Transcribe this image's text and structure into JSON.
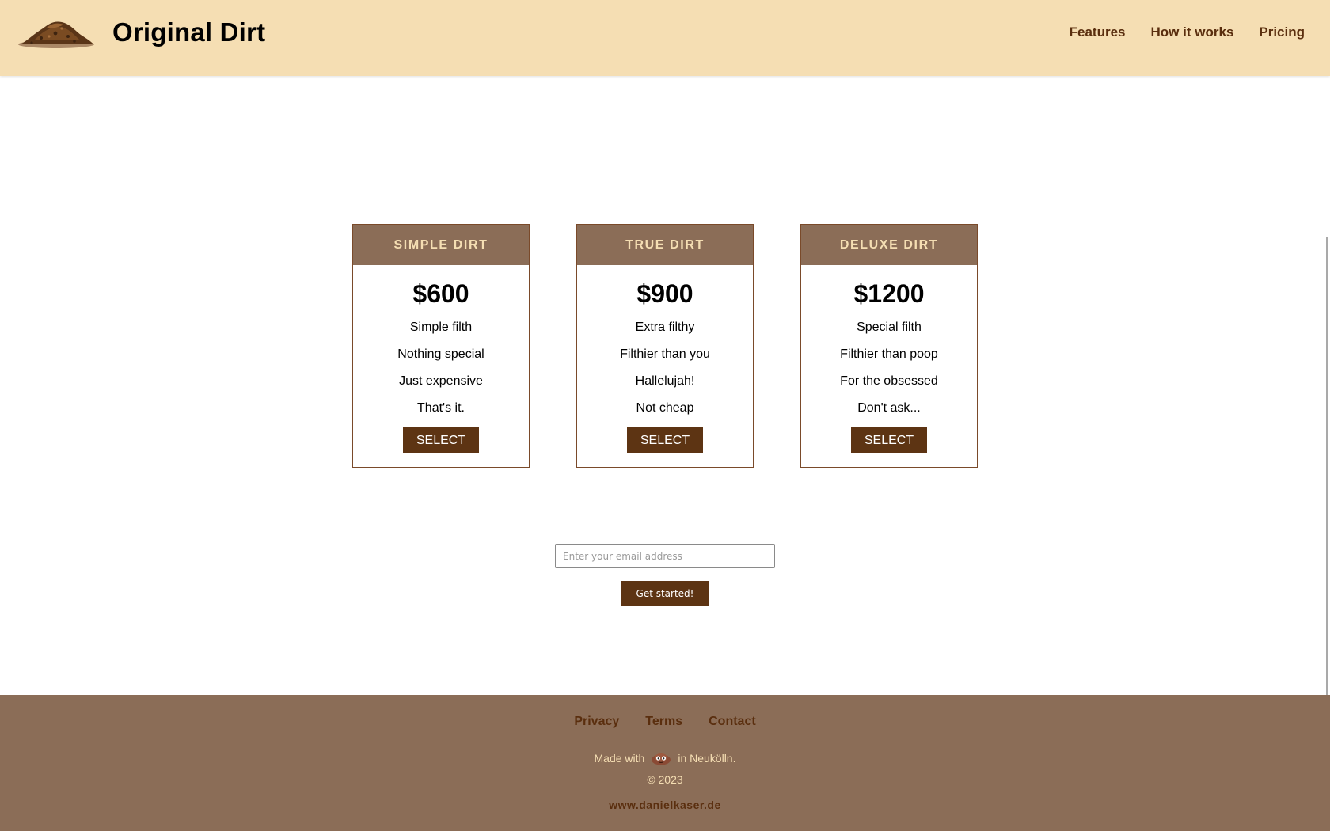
{
  "header": {
    "brand": "Original Dirt",
    "nav": [
      {
        "label": "Features"
      },
      {
        "label": "How it works"
      },
      {
        "label": "Pricing"
      }
    ]
  },
  "plans": [
    {
      "name": "SIMPLE DIRT",
      "price": "$600",
      "features": [
        "Simple filth",
        "Nothing special",
        "Just expensive",
        "That's it."
      ],
      "button": "SELECT"
    },
    {
      "name": "TRUE DIRT",
      "price": "$900",
      "features": [
        "Extra filthy",
        "Filthier than you",
        "Hallelujah!",
        "Not cheap"
      ],
      "button": "SELECT"
    },
    {
      "name": "DELUXE DIRT",
      "price": "$1200",
      "features": [
        "Special filth",
        "Filthier than poop",
        "For the obsessed",
        "Don't ask..."
      ],
      "button": "SELECT"
    }
  ],
  "signup": {
    "email_placeholder": "Enter your email address",
    "email_value": "",
    "button": "Get started!"
  },
  "footer": {
    "links": [
      {
        "label": "Privacy"
      },
      {
        "label": "Terms"
      },
      {
        "label": "Contact"
      }
    ],
    "made_with_prefix": "Made with",
    "made_with_icon": "dirt-face-icon",
    "made_with_suffix": "in Neukölln.",
    "copyright": "© 2023",
    "site": "www.danielkaser.de"
  },
  "colors": {
    "header_bg": "#f5deb3",
    "card_head_bg": "#8b6d57",
    "button_bg": "#5d3413",
    "nav_text": "#5a2e0e",
    "footer_bg": "#8b6d57"
  }
}
